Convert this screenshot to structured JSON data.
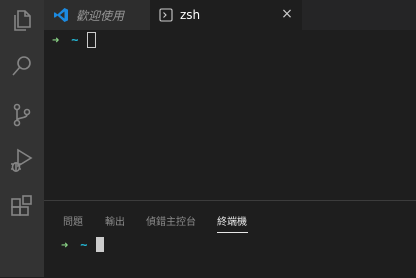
{
  "activity_bar": {
    "icons": [
      "files-icon",
      "search-icon",
      "source-control-icon",
      "run-debug-icon",
      "extensions-icon"
    ]
  },
  "tabs": [
    {
      "label": "歡迎使用",
      "icon": "vscode-logo-icon",
      "active": false
    },
    {
      "label": "zsh",
      "icon": "terminal-icon",
      "active": true,
      "close": "×"
    }
  ],
  "editor_terminal": {
    "arrow": "➜",
    "dir": "~"
  },
  "panel": {
    "tabs": [
      "問題",
      "輸出",
      "偵錯主控台",
      "終端機"
    ],
    "active_tab": "終端機",
    "terminal": {
      "arrow": "➜",
      "dir": "~"
    }
  },
  "colors": {
    "background": "#1e1e1e",
    "activity_bar": "#333333",
    "prompt_arrow": "#89d185",
    "prompt_dir": "#23b5d3",
    "vscode_blue": "#1c8ae0"
  }
}
